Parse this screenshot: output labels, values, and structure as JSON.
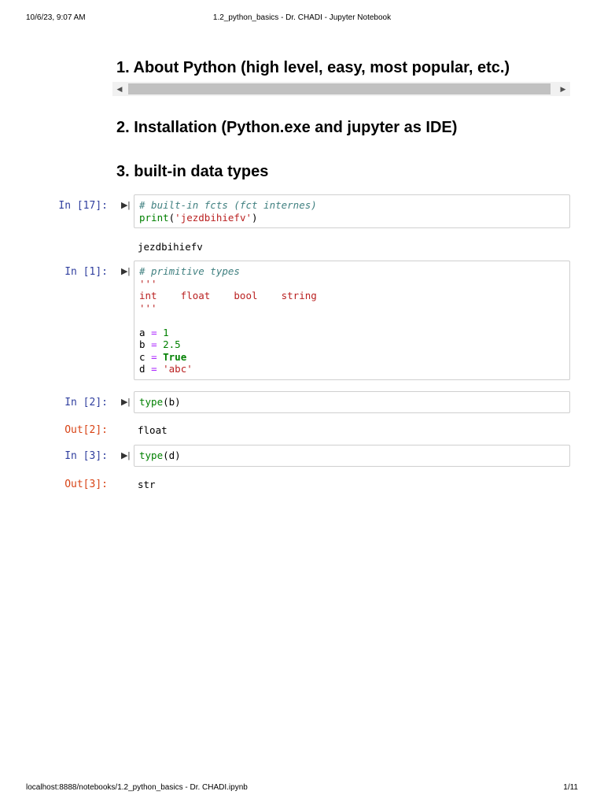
{
  "header": {
    "datetime": "10/6/23, 9:07 AM",
    "title": "1.2_python_basics - Dr. CHADI - Jupyter Notebook"
  },
  "footer": {
    "url": "localhost:8888/notebooks/1.2_python_basics - Dr. CHADI.ipynb",
    "page": "1/11"
  },
  "headings": [
    "1. About Python (high level, easy, most popular, etc.)",
    "2. Installation (Python.exe and jupyter as IDE)",
    "3. built-in data types"
  ],
  "cells": [
    {
      "prompt": "In [17]:",
      "lines": [
        [
          [
            "c",
            "# built-in fcts (fct internes)"
          ]
        ],
        [
          [
            "b",
            "print"
          ],
          [
            "t",
            "("
          ],
          [
            "s",
            "'jezdbihiefv'"
          ],
          [
            "t",
            ")"
          ]
        ]
      ],
      "output_prompt": "",
      "output": "jezdbihiefv"
    },
    {
      "prompt": "In [1]:",
      "lines": [
        [
          [
            "c",
            "# primitive types"
          ]
        ],
        [
          [
            "s",
            "'''"
          ]
        ],
        [
          [
            "s",
            "int    float    bool    string"
          ]
        ],
        [
          [
            "s",
            "'''"
          ]
        ],
        [],
        [
          [
            "t",
            "a "
          ],
          [
            "o",
            "="
          ],
          [
            "t",
            " "
          ],
          [
            "n",
            "1"
          ]
        ],
        [
          [
            "t",
            "b "
          ],
          [
            "o",
            "="
          ],
          [
            "t",
            " "
          ],
          [
            "n",
            "2.5"
          ]
        ],
        [
          [
            "t",
            "c "
          ],
          [
            "o",
            "="
          ],
          [
            "t",
            " "
          ],
          [
            "k",
            "True"
          ]
        ],
        [
          [
            "t",
            "d "
          ],
          [
            "o",
            "="
          ],
          [
            "t",
            " "
          ],
          [
            "s",
            "'abc'"
          ]
        ]
      ],
      "output_prompt": "",
      "output": ""
    },
    {
      "prompt": "In [2]:",
      "lines": [
        [
          [
            "b",
            "type"
          ],
          [
            "t",
            "(b)"
          ]
        ]
      ],
      "output_prompt": "Out[2]:",
      "output": "float"
    },
    {
      "prompt": "In [3]:",
      "lines": [
        [
          [
            "b",
            "type"
          ],
          [
            "t",
            "(d)"
          ]
        ]
      ],
      "output_prompt": "Out[3]:",
      "output": "str"
    }
  ]
}
